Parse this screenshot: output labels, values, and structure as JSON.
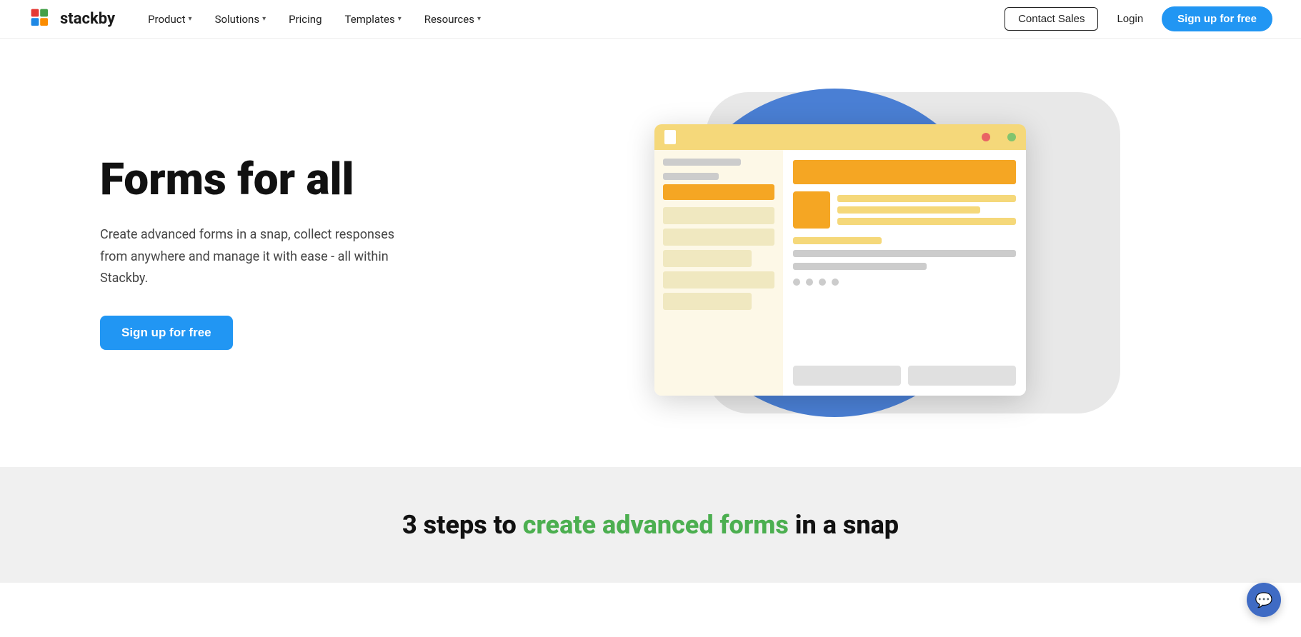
{
  "nav": {
    "logo_text": "stackby",
    "items": [
      {
        "label": "Product",
        "has_dropdown": true
      },
      {
        "label": "Solutions",
        "has_dropdown": true
      },
      {
        "label": "Pricing",
        "has_dropdown": false
      },
      {
        "label": "Templates",
        "has_dropdown": true
      },
      {
        "label": "Resources",
        "has_dropdown": true
      }
    ],
    "contact_sales_label": "Contact Sales",
    "login_label": "Login",
    "signup_label": "Sign up for free"
  },
  "hero": {
    "title": "Forms for all",
    "description": "Create advanced forms in a snap, collect responses from anywhere and manage it with ease - all within Stackby.",
    "signup_btn_label": "Sign up for free"
  },
  "bottom": {
    "heading_part1": "3 steps to ",
    "heading_highlight": "create advanced forms",
    "heading_part2": " in a snap"
  },
  "colors": {
    "blue_accent": "#2196f3",
    "hero_circle": "#4a7fd4",
    "brand_orange": "#f5a623",
    "brand_yellow_bar": "#f5d87a",
    "green_highlight": "#4caf50",
    "chat_btn": "#3f6bc4"
  }
}
